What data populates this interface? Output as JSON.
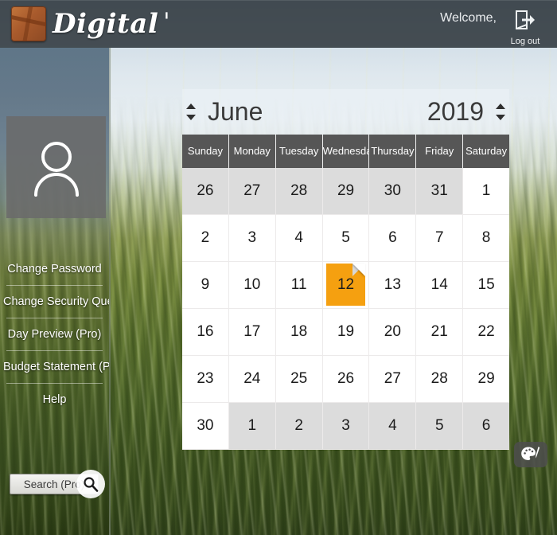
{
  "header": {
    "logo_text": "Digital",
    "logo_suffix": "'",
    "logo_icon": "wallet-icon",
    "welcome_text": "Welcome,",
    "logout_label": "Log out",
    "logout_icon": "logout-arrow-icon"
  },
  "sidebar": {
    "avatar_icon": "user-avatar-icon",
    "items": [
      {
        "label": "Change Password"
      },
      {
        "label": "Change Security Que"
      },
      {
        "label": "Day Preview (Pro)"
      },
      {
        "label": "Budget Statement (P"
      },
      {
        "label": "Help"
      }
    ],
    "search": {
      "value": "Search (Pro)",
      "placeholder": "Search (Pro)",
      "icon": "search-icon"
    }
  },
  "calendar": {
    "month": "June",
    "year": "2019",
    "month_prev_icon": "chevron-up-icon",
    "month_next_icon": "chevron-down-icon",
    "year_prev_icon": "chevron-up-icon",
    "year_next_icon": "chevron-down-icon",
    "day_headers": [
      "Sunday",
      "Monday",
      "Tuesday",
      "Wednesday",
      "Thursday",
      "Friday",
      "Saturday"
    ],
    "selected_day": 12,
    "accent_color": "#f5a010",
    "weeks": [
      [
        {
          "n": "26",
          "other": true
        },
        {
          "n": "27",
          "other": true
        },
        {
          "n": "28",
          "other": true
        },
        {
          "n": "29",
          "other": true
        },
        {
          "n": "30",
          "other": true
        },
        {
          "n": "31",
          "other": true
        },
        {
          "n": "1",
          "other": false
        }
      ],
      [
        {
          "n": "2",
          "other": false
        },
        {
          "n": "3",
          "other": false
        },
        {
          "n": "4",
          "other": false
        },
        {
          "n": "5",
          "other": false
        },
        {
          "n": "6",
          "other": false
        },
        {
          "n": "7",
          "other": false
        },
        {
          "n": "8",
          "other": false
        }
      ],
      [
        {
          "n": "9",
          "other": false
        },
        {
          "n": "10",
          "other": false
        },
        {
          "n": "11",
          "other": false
        },
        {
          "n": "12",
          "other": false,
          "selected": true
        },
        {
          "n": "13",
          "other": false
        },
        {
          "n": "14",
          "other": false
        },
        {
          "n": "15",
          "other": false
        }
      ],
      [
        {
          "n": "16",
          "other": false
        },
        {
          "n": "17",
          "other": false
        },
        {
          "n": "18",
          "other": false
        },
        {
          "n": "19",
          "other": false
        },
        {
          "n": "20",
          "other": false
        },
        {
          "n": "21",
          "other": false
        },
        {
          "n": "22",
          "other": false
        }
      ],
      [
        {
          "n": "23",
          "other": false
        },
        {
          "n": "24",
          "other": false
        },
        {
          "n": "25",
          "other": false
        },
        {
          "n": "26",
          "other": false
        },
        {
          "n": "27",
          "other": false
        },
        {
          "n": "28",
          "other": false
        },
        {
          "n": "29",
          "other": false
        }
      ],
      [
        {
          "n": "30",
          "other": false
        },
        {
          "n": "1",
          "other": true
        },
        {
          "n": "2",
          "other": true
        },
        {
          "n": "3",
          "other": true
        },
        {
          "n": "4",
          "other": true
        },
        {
          "n": "5",
          "other": true
        },
        {
          "n": "6",
          "other": true
        }
      ]
    ]
  },
  "theme_button": {
    "icon": "palette-icon"
  }
}
